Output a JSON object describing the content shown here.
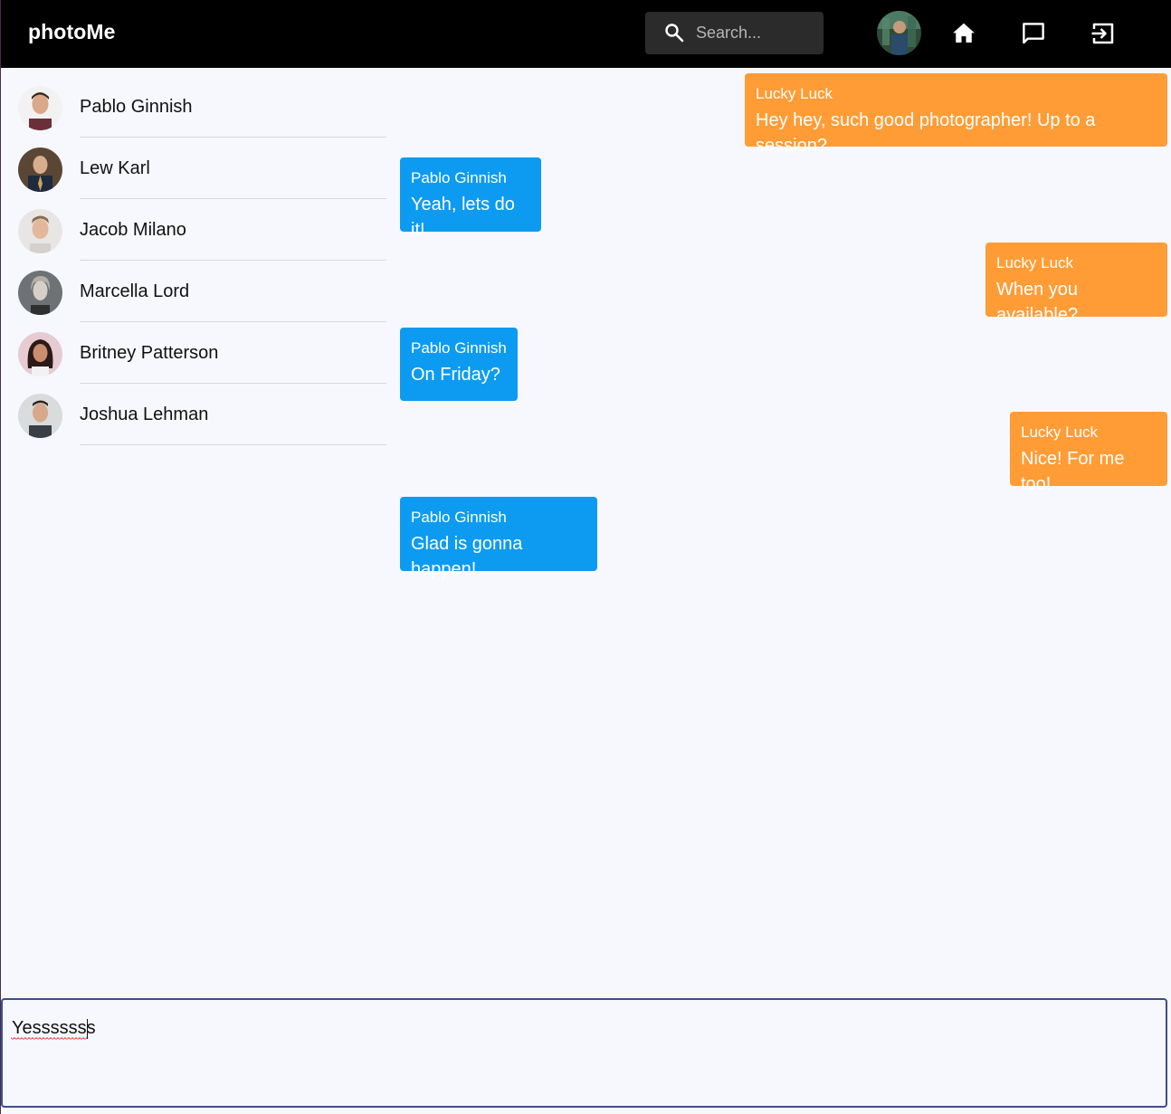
{
  "app": {
    "brand": "photoMe"
  },
  "search": {
    "placeholder": "Search..."
  },
  "contacts": [
    {
      "name": "Pablo Ginnish"
    },
    {
      "name": "Lew Karl"
    },
    {
      "name": "Jacob Milano"
    },
    {
      "name": "Marcella Lord"
    },
    {
      "name": "Britney Patterson"
    },
    {
      "name": "Joshua Lehman"
    }
  ],
  "messages": [
    {
      "sender": "Lucky Luck",
      "text": "Hey hey, such good photographer! Up to a session?",
      "mine": true
    },
    {
      "sender": "Pablo Ginnish",
      "text": "Yeah, lets do it!",
      "mine": false
    },
    {
      "sender": "Lucky Luck",
      "text": "When you available?",
      "mine": true
    },
    {
      "sender": "Pablo Ginnish",
      "text": "On Friday?",
      "mine": false
    },
    {
      "sender": "Lucky Luck",
      "text": "Nice! For me too!",
      "mine": true
    },
    {
      "sender": "Pablo Ginnish",
      "text": "Glad is gonna happen!",
      "mine": false
    }
  ],
  "compose": {
    "value": "Yesssssss"
  },
  "colors": {
    "topbar": "#000000",
    "mine_bubble": "#ff9c36",
    "theirs_bubble": "#0d9bf2",
    "background": "#f7f8fd"
  },
  "icons": {
    "search": "search-icon",
    "home": "home-icon",
    "chat": "chat-icon",
    "logout": "logout-icon"
  }
}
